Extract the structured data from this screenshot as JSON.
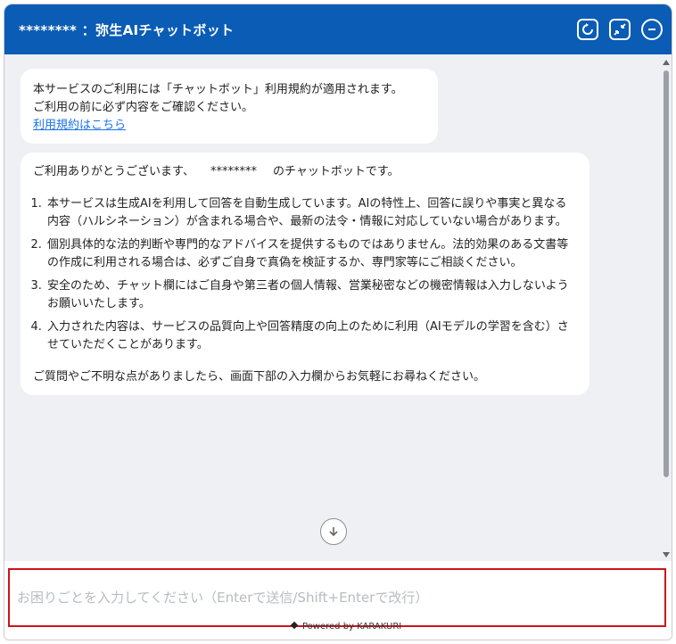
{
  "header": {
    "title": "******** ：弥生AIチャットボット",
    "icons": [
      "refresh-icon",
      "shrink-icon",
      "minimize-icon"
    ]
  },
  "messages": {
    "terms": {
      "line1": "本サービスのご利用には「チャットボット」利用規約が適用されます。",
      "line2": "ご利用の前に必ず内容をご確認ください。",
      "link": "利用規約はこちら"
    },
    "welcome": {
      "greeting_prefix": "ご利用ありがとうございます、",
      "greeting_mask": "********",
      "greeting_suffix": "のチャットボットです。",
      "items": [
        "本サービスは生成AIを利用して回答を自動生成しています。AIの特性上、回答に誤りや事実と異なる内容（ハルシネーション）が含まれる場合や、最新の法令・情報に対応していない場合があります。",
        "個別具体的な法的判断や専門的なアドバイスを提供するものではありません。法的効果のある文書等の作成に利用される場合は、必ずご自身で真偽を検証するか、専門家等にご相談ください。",
        "安全のため、チャット欄にはご自身や第三者の個人情報、営業秘密などの機密情報は入力しないようお願いいたします。",
        "入力された内容は、サービスの品質向上や回答精度の向上のために利用（AIモデルの学習を含む）させていただくことがあります。"
      ],
      "closing": "ご質問やご不明な点がありましたら、画面下部の入力欄からお気軽にお尋ねください。"
    }
  },
  "input": {
    "placeholder": "お困りごとを入力してください（Enterで送信/Shift+Enterで改行）",
    "value": ""
  },
  "footer": {
    "powered_by": "Powered by KARAKURI"
  },
  "colors": {
    "header_bg": "#0a5cb5",
    "link": "#1a73e8",
    "highlight_border": "#d0121b"
  }
}
